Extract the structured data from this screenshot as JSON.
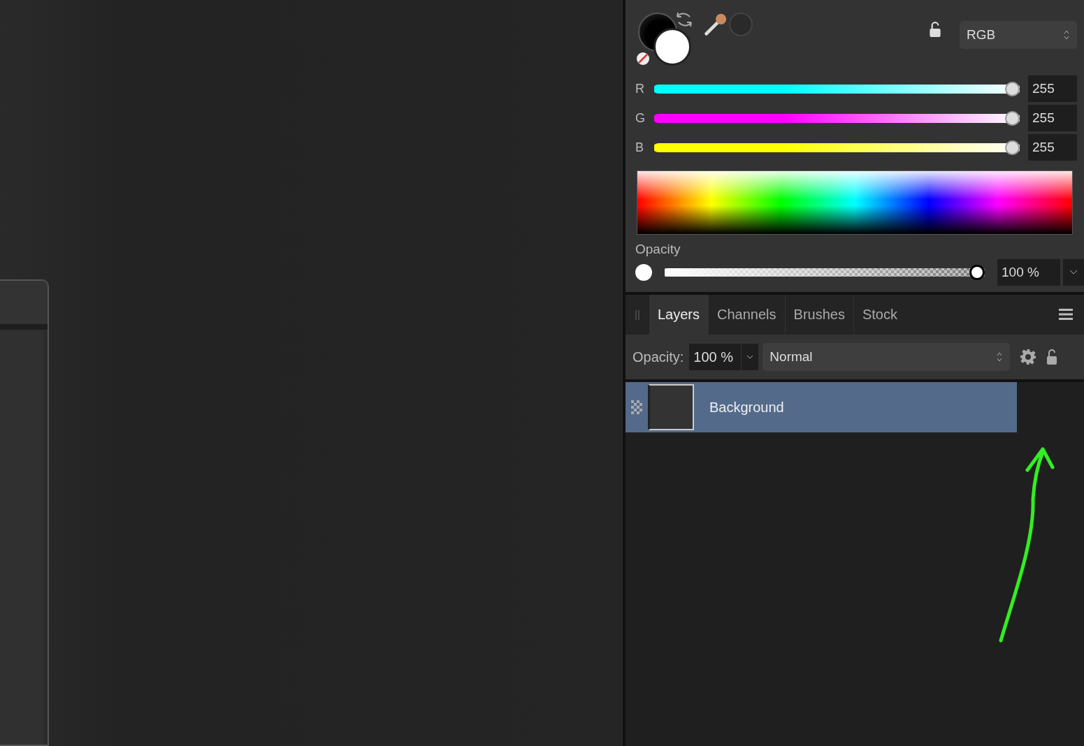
{
  "color_panel": {
    "model": "RGB",
    "channels": [
      {
        "label": "R",
        "color": "#00ffff",
        "level": 1,
        "value": "255"
      },
      {
        "label": "G",
        "color": "#ff00ff",
        "level": 1,
        "value": "255"
      },
      {
        "label": "B",
        "color": "#ffff00",
        "level": 1,
        "value": "255"
      }
    ],
    "opacity": {
      "label": "Opacity",
      "level": 1,
      "value": "100 %"
    }
  },
  "layers_panel": {
    "tabs": [
      {
        "label": "Layers",
        "selected": true
      },
      {
        "label": "Channels",
        "selected": false
      },
      {
        "label": "Brushes",
        "selected": false
      },
      {
        "label": "Stock",
        "selected": false
      }
    ],
    "opacity_label": "Opacity:",
    "opacity_value": "100 %",
    "blend_mode": "Normal",
    "layers": [
      {
        "name": "Background",
        "selected": true
      }
    ]
  }
}
